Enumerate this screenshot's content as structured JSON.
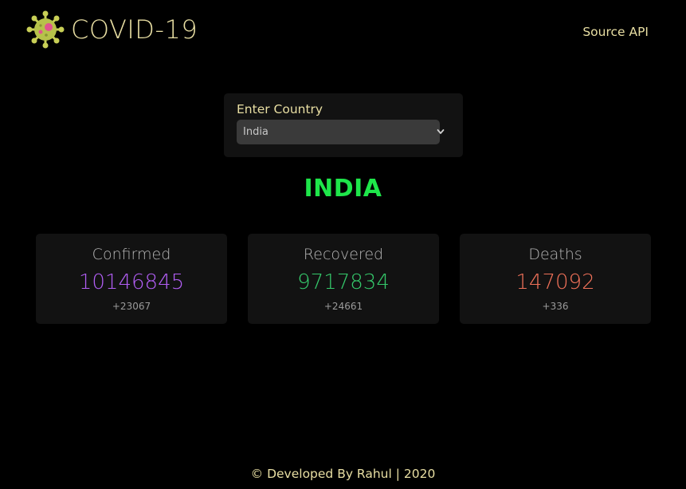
{
  "header": {
    "title": "COVID-19",
    "logo_icon": "virus-icon",
    "nav_link": "Source API"
  },
  "selector": {
    "label": "Enter Country",
    "selected": "India",
    "icon": "chevron-down-icon"
  },
  "country_heading": "INDIA",
  "stats": {
    "confirmed": {
      "label": "Confirmed",
      "value": "10146845",
      "delta": "+23067",
      "color": "#b25ef5"
    },
    "recovered": {
      "label": "Recovered",
      "value": "9717834",
      "delta": "+24661",
      "color": "#35c96b"
    },
    "deaths": {
      "label": "Deaths",
      "value": "147092",
      "delta": "+336",
      "color": "#f07159"
    }
  },
  "footer": {
    "text": "© Developed By Rahul | 2020"
  },
  "colors": {
    "accent_text": "#e9dfa3",
    "heading_green": "#1ee64a",
    "card_bg": "#121212",
    "page_bg": "#000000"
  }
}
